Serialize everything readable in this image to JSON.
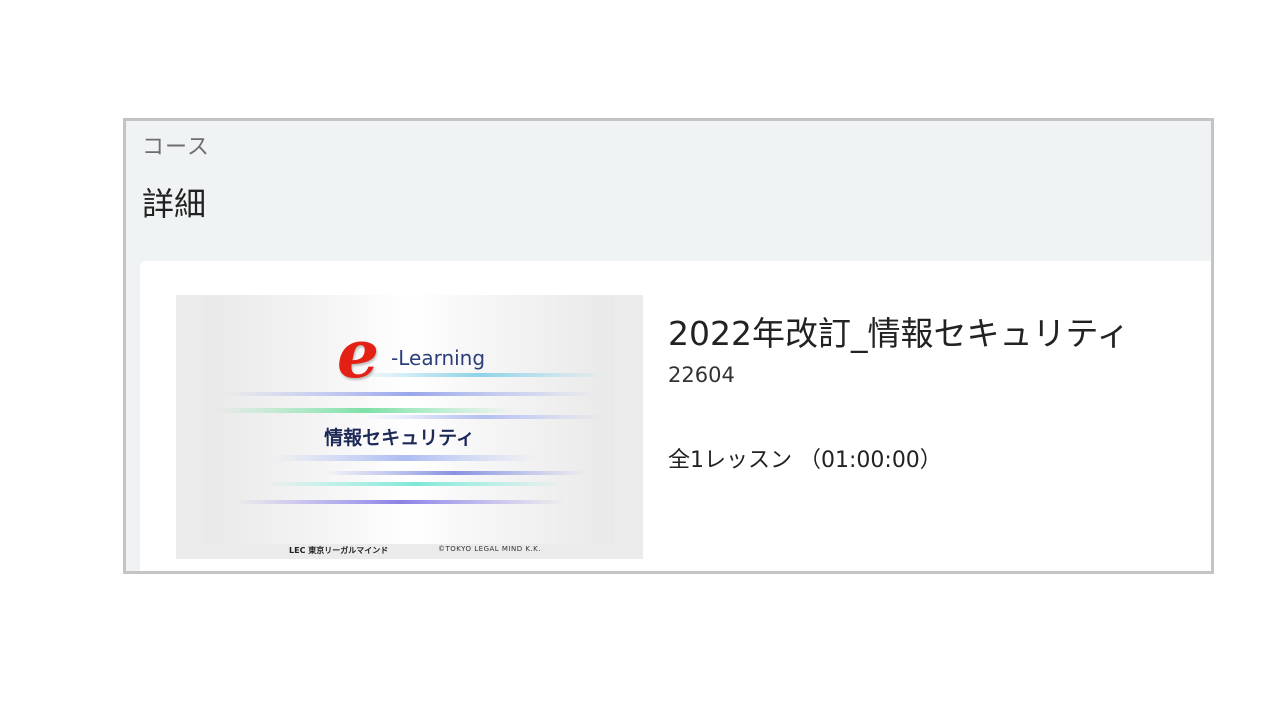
{
  "header": {
    "breadcrumb": "コース",
    "title": "詳細"
  },
  "course": {
    "title": "2022年改訂_情報セキュリティ",
    "code": "22604",
    "lesson_count_label": "全1レッスン",
    "duration_label": "（01:00:00）",
    "thumbnail": {
      "logo_letter": "e",
      "logo_text": "-Learning",
      "slide_title": "情報セキュリティ",
      "footer_logo": "LEC 東京リーガルマインド",
      "footer_copyright": "©TOKYO LEGAL MIND K.K."
    }
  },
  "colors": {
    "page_background": "#ffffff",
    "panel_background": "#f0f3f4",
    "frame_border": "#c4c4c4",
    "card_background": "#ffffff",
    "logo_red": "#e41f13"
  }
}
